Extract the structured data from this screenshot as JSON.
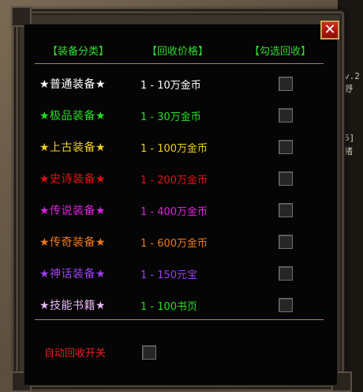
{
  "window": {
    "close_glyph": "✕",
    "columns": [
      "【装备分类】",
      "【回收价格】",
      "【勾选回收】"
    ]
  },
  "rows": [
    {
      "name": "★普通装备★",
      "price": "1 - 10万金币",
      "name_color": "#ffffff",
      "price_color": "#ffffff",
      "checked": false
    },
    {
      "name": "★极品装备★",
      "price": "1 - 30万金币",
      "name_color": "#22e022",
      "price_color": "#22e022",
      "checked": false
    },
    {
      "name": "★上古装备★",
      "price": "1 - 100万金币",
      "name_color": "#f0d020",
      "price_color": "#f0d020",
      "checked": false
    },
    {
      "name": "★史诗装备★",
      "price": "1 - 200万金币",
      "name_color": "#e81010",
      "price_color": "#e81010",
      "checked": false
    },
    {
      "name": "★传说装备★",
      "price": "1 - 400万金币",
      "name_color": "#e020e0",
      "price_color": "#e020e0",
      "checked": false
    },
    {
      "name": "★传奇装备★",
      "price": "1 - 600万金币",
      "name_color": "#f07818",
      "price_color": "#f07818",
      "checked": false
    },
    {
      "name": "★神话装备★",
      "price": "1 - 150元宝",
      "name_color": "#9a40f0",
      "price_color": "#9a40f0",
      "checked": false
    },
    {
      "name": "★技能书籍★",
      "price": "1 - 100书页",
      "name_color": "#e8b8f8",
      "price_color": "#22e022",
      "checked": false
    }
  ],
  "auto_recycle": {
    "label": "自动回收开关",
    "checked": false
  },
  "background_fragments": [
    "v.2",
    "野",
    "6]",
    "猪"
  ],
  "colors": {
    "header_green": "#2fdc2f",
    "separator_gold": "#a58a45",
    "close_red": "#d2281e"
  }
}
